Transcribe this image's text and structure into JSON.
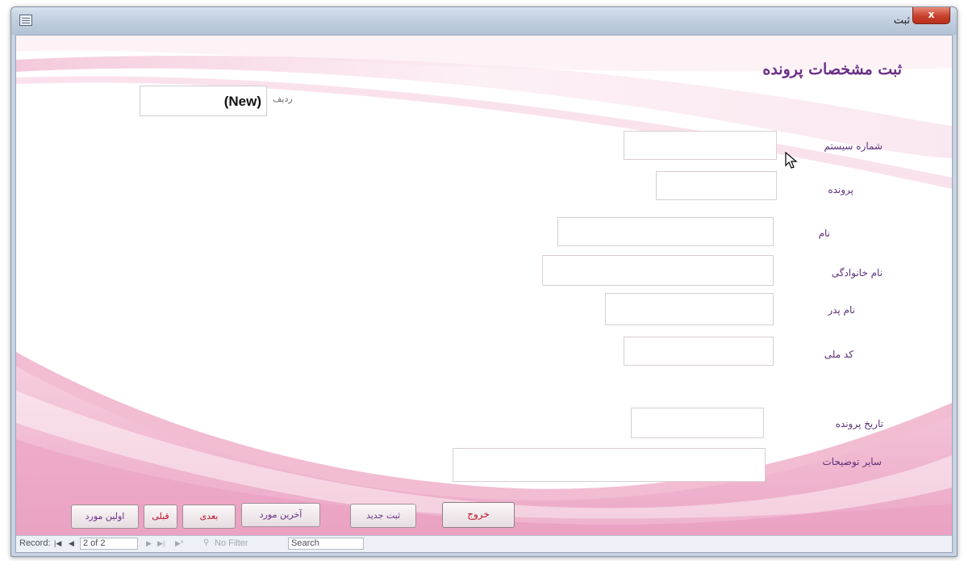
{
  "window": {
    "title": "ثبت",
    "close_label": "x"
  },
  "form": {
    "title": "ثبت مشخصات پرونده",
    "row_label": "ردیف",
    "row_value": "(New)",
    "fields": [
      {
        "label": "شماره سیستم",
        "value": ""
      },
      {
        "label": "پرونده",
        "value": ""
      },
      {
        "label": "نام",
        "value": ""
      },
      {
        "label": "نام خانوادگی",
        "value": ""
      },
      {
        "label": "نام پدر",
        "value": ""
      },
      {
        "label": "کد ملی",
        "value": ""
      },
      {
        "label": "تاریخ پرونده",
        "value": ""
      },
      {
        "label": "سایر توضیحات",
        "value": ""
      }
    ]
  },
  "buttons": {
    "first": "اولین مورد",
    "prev": "قبلی",
    "next": "بعدی",
    "last": "آخرین مورد",
    "new": "ثبت جدید",
    "exit": "خروج"
  },
  "navbar": {
    "record_label": "Record:",
    "first_glyph": "|◀",
    "prev_glyph": "◀",
    "position": "2 of 2",
    "next_glyph": "▶",
    "last_glyph": "▶|",
    "new_glyph": "▶*",
    "filter_label": "No Filter",
    "search_label": "Search"
  },
  "colors": {
    "accent_purple": "#6b2f86",
    "button_red": "#c0132a",
    "pink_background": "#efb2cd"
  },
  "icons": {
    "app": "form-icon",
    "filter": "filter-icon",
    "cursor": "mouse-pointer-icon"
  }
}
